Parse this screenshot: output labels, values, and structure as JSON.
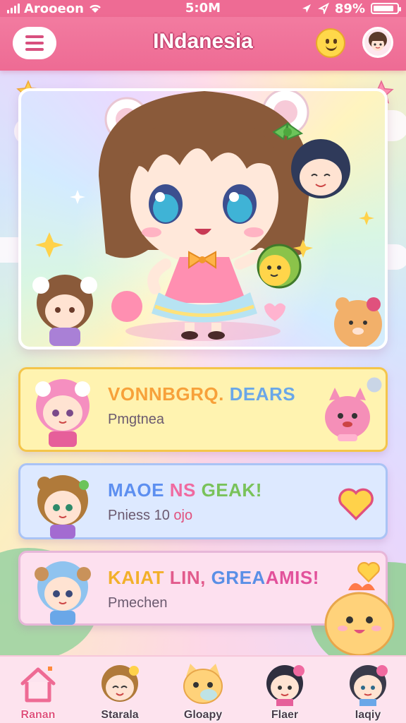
{
  "status_bar": {
    "carrier": "Arooeon",
    "time": "5:0M",
    "battery": "89%",
    "battery_level": 0.89
  },
  "header": {
    "title": "INdanesia"
  },
  "cards": [
    {
      "title_parts": [
        {
          "text": "VONNBGRQ. ",
          "color": "#f7a13a"
        },
        {
          "text": "DEARS",
          "color": "#6aa7e8"
        }
      ],
      "subtitle": "Pmgtnea",
      "subtitle_highlight": "",
      "bg": "#fff3b0",
      "border": "#f4c54a"
    },
    {
      "title_parts": [
        {
          "text": "MAOE ",
          "color": "#5d8ff0"
        },
        {
          "text": "NS ",
          "color": "#f06aa0"
        },
        {
          "text": " GEAK!",
          "color": "#79c25a"
        }
      ],
      "subtitle": "Pniess 10 ",
      "subtitle_highlight": "ojo",
      "bg": "#dde9ff",
      "border": "#a9c3f5"
    },
    {
      "title_parts": [
        {
          "text": "KAIAT ",
          "color": "#f2b02a"
        },
        {
          "text": "LIN, ",
          "color": "#e25b8c"
        },
        {
          "text": "GREA",
          "color": "#5a8fe6"
        },
        {
          "text": "AMIS!",
          "color": "#e2519b"
        }
      ],
      "subtitle": "Pmechen",
      "subtitle_highlight": "",
      "bg": "#fde0ef",
      "border": "#e7b6d8"
    }
  ],
  "nav": [
    {
      "label": "Ranan",
      "icon": "home-icon",
      "active": true
    },
    {
      "label": "Starala",
      "icon": "character-icon",
      "active": false
    },
    {
      "label": "Gloapy",
      "icon": "cat-icon",
      "active": false
    },
    {
      "label": "Flaer",
      "icon": "character-icon",
      "active": false
    },
    {
      "label": "Iaqiy",
      "icon": "character-icon",
      "active": false
    }
  ],
  "colors": {
    "header": "#ee6b94",
    "accent": "#e0517d"
  }
}
